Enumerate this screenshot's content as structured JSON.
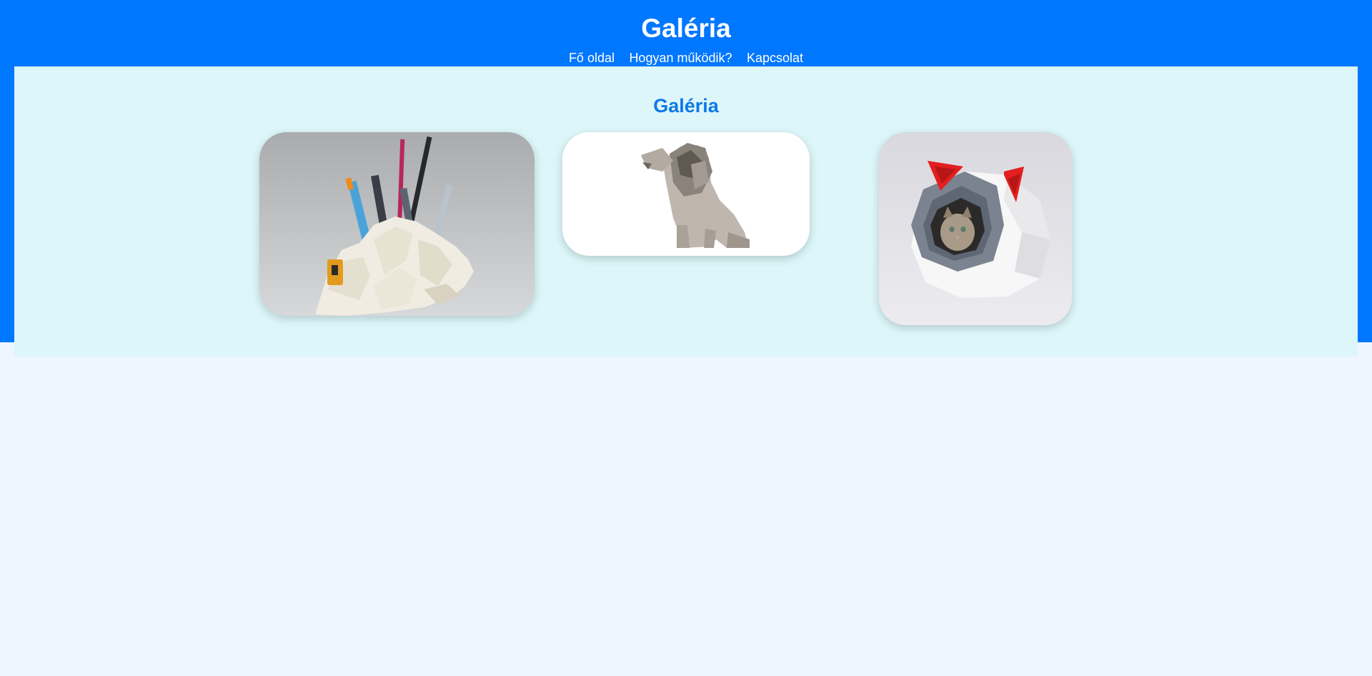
{
  "header": {
    "title": "Galéria",
    "nav": [
      {
        "label": "Fő oldal"
      },
      {
        "label": "Hogyan működik?"
      },
      {
        "label": "Kapcsolat"
      }
    ]
  },
  "gallery": {
    "title": "Galéria",
    "images": [
      {
        "name": "pen-holder-photo"
      },
      {
        "name": "lion-statue-photo"
      },
      {
        "name": "cat-house-photo"
      }
    ]
  },
  "colors": {
    "header_bg": "#0077ff",
    "panel_bg": "#dcf6f9",
    "page_bg": "#eef6ff",
    "gallery_title": "#0f78e8"
  }
}
